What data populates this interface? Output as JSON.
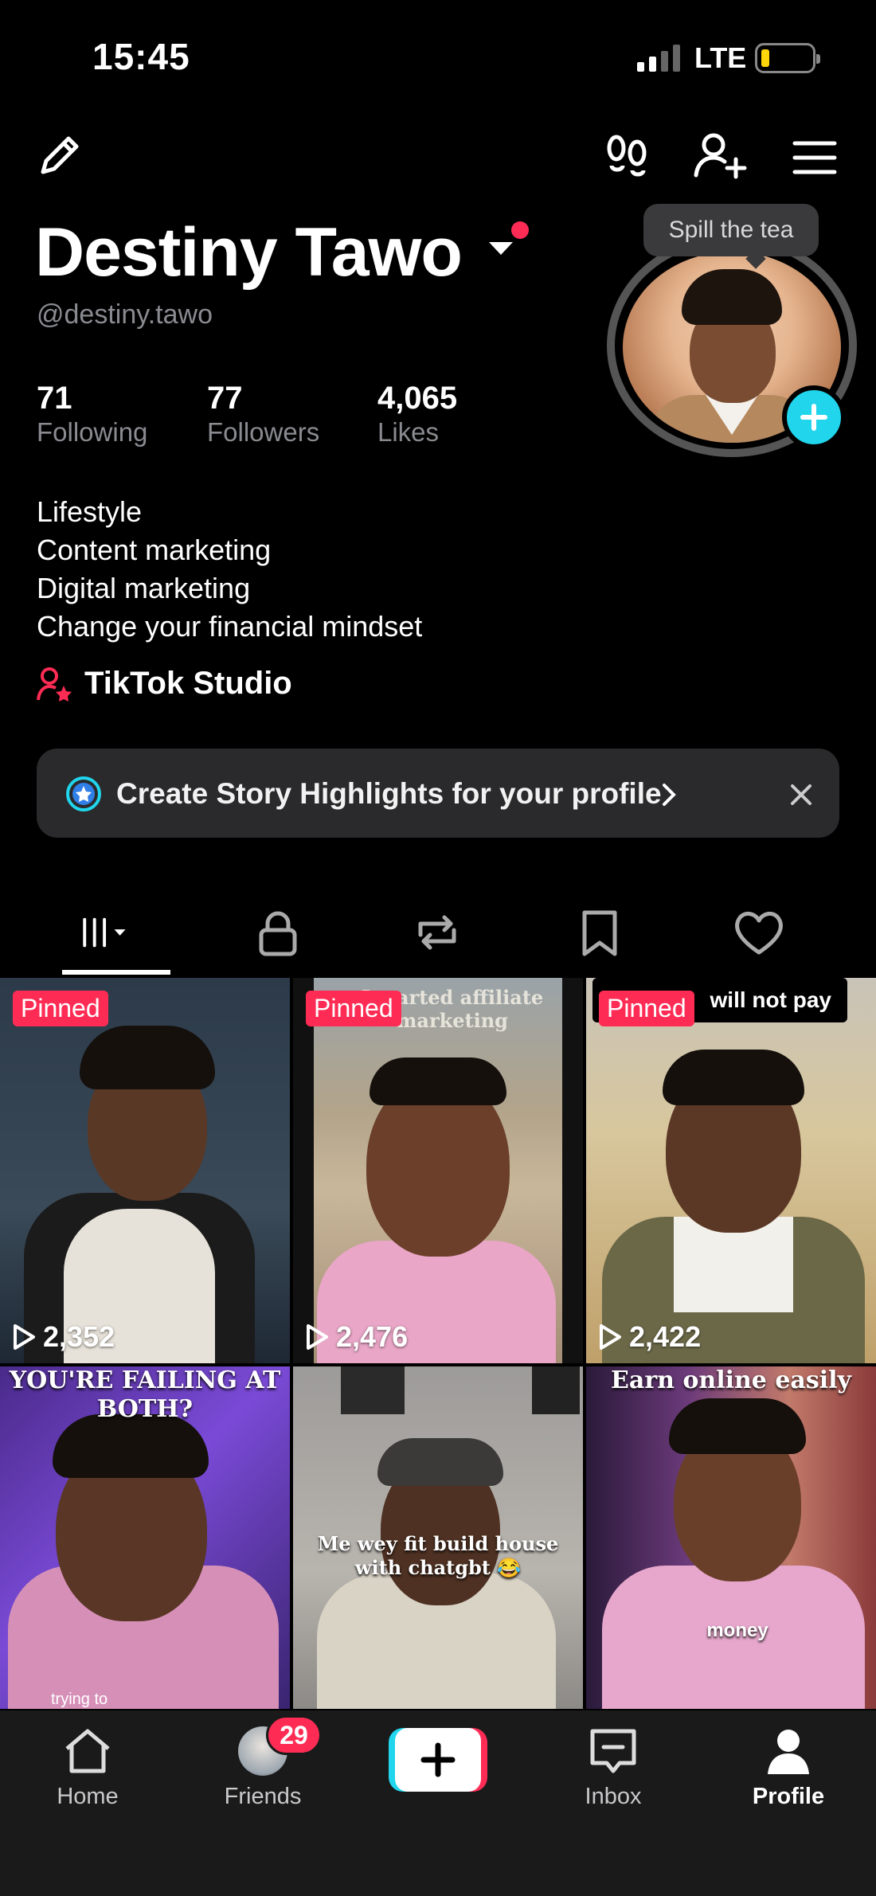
{
  "status_bar": {
    "time": "15:45",
    "network": "LTE"
  },
  "profile": {
    "name": "Destiny Tawo",
    "handle": "@destiny.tawo",
    "stats": [
      {
        "value": "71",
        "label": "Following"
      },
      {
        "value": "77",
        "label": "Followers"
      },
      {
        "value": "4,065",
        "label": "Likes"
      }
    ],
    "bio": [
      "Lifestyle",
      "Content marketing",
      "Digital marketing",
      "Change your financial mindset"
    ],
    "studio_label": "TikTok Studio",
    "note_bubble": "Spill the tea"
  },
  "highlight_banner": {
    "text": "Create Story Highlights for your profile"
  },
  "tabs": [
    {
      "icon": "grid-icon",
      "active": true
    },
    {
      "icon": "lock-icon"
    },
    {
      "icon": "repost-icon"
    },
    {
      "icon": "bookmark-icon"
    },
    {
      "icon": "heart-icon"
    }
  ],
  "videos": [
    {
      "pinned": "Pinned",
      "views": "2,352"
    },
    {
      "pinned": "Pinned",
      "views": "2,476",
      "caption": "I started affiliate marketing"
    },
    {
      "pinned": "Pinned",
      "views": "2,422",
      "caption": "will not pay"
    },
    {
      "caption": "YOU'RE FAILING AT BOTH?",
      "caption2": "trying to"
    },
    {
      "caption": "Me wey fit build house with chatgbt 😂"
    },
    {
      "caption": "Earn online easily",
      "caption2": "money"
    }
  ],
  "bottom_nav": {
    "items": [
      "Home",
      "Friends",
      "Inbox",
      "Profile"
    ],
    "friends_badge": "29",
    "active": "Profile"
  },
  "colors": {
    "accent": "#fe2c55",
    "cyan": "#20d5ec",
    "background": "#000000"
  }
}
